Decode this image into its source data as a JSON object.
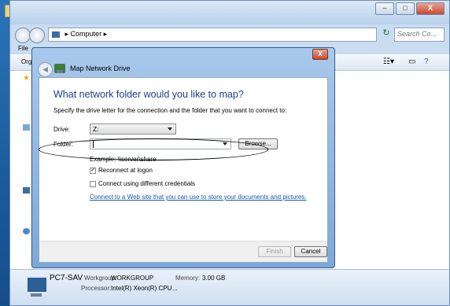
{
  "explorer": {
    "breadcrumb": "Computer",
    "search_placeholder": "Search Co...",
    "menu_file": "File",
    "toolbar_organize": "Org",
    "window_buttons": {
      "minimize": "–",
      "maximize": "□",
      "close": "X"
    },
    "details": {
      "computer_name": "PC7-SAV",
      "workgroup_label": "Workgroup:",
      "workgroup_value": "WORKGROUP",
      "memory_label": "Memory:",
      "memory_value": "3.00 GB",
      "processor_label": "Processor:",
      "processor_value": "Intel(R) Xeon(R) CPU",
      "processor_ellipsis": "..."
    }
  },
  "dialog": {
    "title": "Map Network Drive",
    "close_label": "X",
    "heading": "What network folder would you like to map?",
    "instruction": "Specify the drive letter for the connection and the folder that you want to connect to:",
    "drive_label": "Drive:",
    "drive_value": "Z:",
    "folder_label": "Folder:",
    "folder_value": "",
    "browse_label": "Browse...",
    "example": "Example: \\\\server\\share",
    "reconnect_label": "Reconnect at logon",
    "reconnect_checked": true,
    "credentials_label": "Connect using different credentials",
    "credentials_checked": false,
    "web_link": "Connect to a Web site that you can use to store your documents and pictures.",
    "finish_label": "Finish",
    "cancel_label": "Cancel"
  },
  "colors": {
    "heading": "#1e3f8a",
    "link": "#1657a8",
    "title_bar": "#a9c8ec"
  }
}
